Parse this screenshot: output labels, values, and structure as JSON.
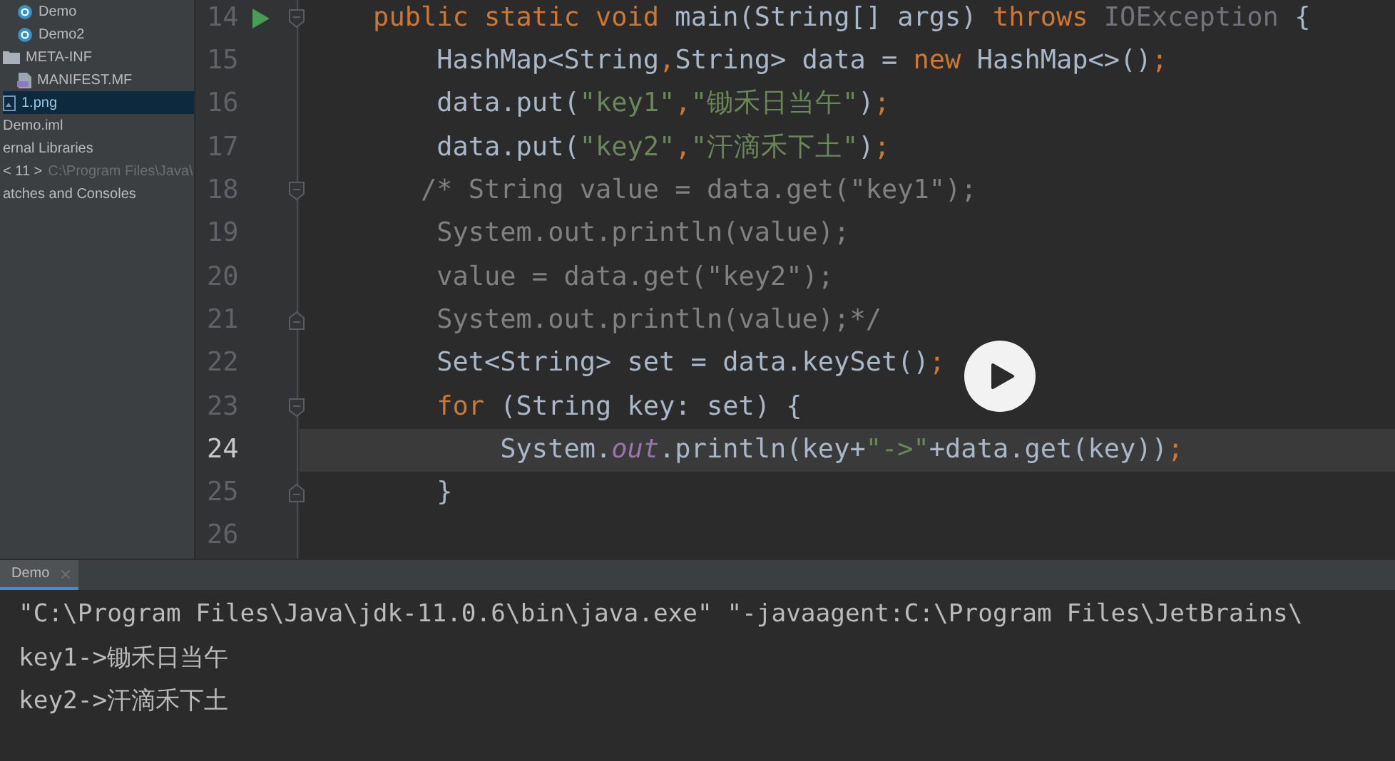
{
  "project_tree": [
    {
      "label": "Demo",
      "kind": "class",
      "selected": false
    },
    {
      "label": "Demo2",
      "kind": "class",
      "selected": false
    },
    {
      "label": "META-INF",
      "kind": "folder",
      "selected": false,
      "children": [
        {
          "label": "MANIFEST.MF",
          "kind": "manifest",
          "selected": false
        }
      ]
    },
    {
      "label": "1.png",
      "kind": "image",
      "selected": true
    },
    {
      "label": "Demo.iml",
      "kind": "module",
      "selected": false
    },
    {
      "label": "ernal Libraries",
      "kind": "plain",
      "selected": false
    },
    {
      "label": "< 11 >",
      "detail": "C:\\Program Files\\Java\\",
      "kind": "plain",
      "selected": false
    },
    {
      "label": "atches and Consoles",
      "kind": "plain",
      "selected": false
    }
  ],
  "editor": {
    "lines": [
      {
        "number": "14",
        "current": false,
        "markers": [
          {
            "kind": "run"
          },
          {
            "kind": "fold_start"
          }
        ],
        "tokens": [
          {
            "kind": "keyword",
            "text": "    public static void"
          },
          {
            "kind": "plain",
            "text": " main(String[] args) "
          },
          {
            "kind": "keyword",
            "text": "throws"
          },
          {
            "kind": "unused",
            "text": " IOException"
          },
          {
            "kind": "plain",
            "text": " {"
          }
        ]
      },
      {
        "number": "15",
        "current": false,
        "tokens": [
          {
            "kind": "plain",
            "text": "        HashMap<String"
          },
          {
            "kind": "keyword",
            "text": ","
          },
          {
            "kind": "plain",
            "text": "String> data = "
          },
          {
            "kind": "keyword",
            "text": "new"
          },
          {
            "kind": "plain",
            "text": " HashMap<>()"
          },
          {
            "kind": "keyword",
            "text": ";"
          }
        ]
      },
      {
        "number": "16",
        "current": false,
        "tokens": [
          {
            "kind": "plain",
            "text": "        data.put("
          },
          {
            "kind": "string",
            "text": "\"key1\""
          },
          {
            "kind": "keyword",
            "text": ","
          },
          {
            "kind": "string",
            "text": "\"锄禾日当午\""
          },
          {
            "kind": "plain",
            "text": ")"
          },
          {
            "kind": "keyword",
            "text": ";"
          }
        ]
      },
      {
        "number": "17",
        "current": false,
        "tokens": [
          {
            "kind": "plain",
            "text": "        data.put("
          },
          {
            "kind": "string",
            "text": "\"key2\""
          },
          {
            "kind": "keyword",
            "text": ","
          },
          {
            "kind": "string",
            "text": "\"汗滴禾下土\""
          },
          {
            "kind": "plain",
            "text": ")"
          },
          {
            "kind": "keyword",
            "text": ";"
          }
        ]
      },
      {
        "number": "18",
        "current": false,
        "markers": [
          {
            "kind": "fold_start"
          }
        ],
        "tokens": [
          {
            "kind": "comment",
            "text": "       /* String value = data.get(\"key1\");"
          }
        ]
      },
      {
        "number": "19",
        "current": false,
        "tokens": [
          {
            "kind": "comment",
            "text": "        System.out.println(value);"
          }
        ]
      },
      {
        "number": "20",
        "current": false,
        "tokens": [
          {
            "kind": "comment",
            "text": "        value = data.get(\"key2\");"
          }
        ]
      },
      {
        "number": "21",
        "current": false,
        "markers": [
          {
            "kind": "fold_end"
          }
        ],
        "tokens": [
          {
            "kind": "comment",
            "text": "        System.out.println(value);*/"
          }
        ]
      },
      {
        "number": "22",
        "current": false,
        "tokens": [
          {
            "kind": "plain",
            "text": "        Set<String> set = data.keySet()"
          },
          {
            "kind": "keyword",
            "text": ";"
          }
        ]
      },
      {
        "number": "23",
        "current": false,
        "markers": [
          {
            "kind": "fold_start"
          }
        ],
        "tokens": [
          {
            "kind": "keyword",
            "text": "        for"
          },
          {
            "kind": "plain",
            "text": " (String key: set) {"
          }
        ]
      },
      {
        "number": "24",
        "current": true,
        "tokens": [
          {
            "kind": "plain",
            "text": "            System."
          },
          {
            "kind": "field",
            "text": "out"
          },
          {
            "kind": "plain",
            "text": ".println(key+"
          },
          {
            "kind": "string",
            "text": "\"->\""
          },
          {
            "kind": "plain",
            "text": "+data.get(key))"
          },
          {
            "kind": "keyword",
            "text": ";"
          }
        ]
      },
      {
        "number": "25",
        "current": false,
        "markers": [
          {
            "kind": "fold_end"
          }
        ],
        "tokens": [
          {
            "kind": "plain",
            "text": "        }"
          }
        ]
      },
      {
        "number": "26",
        "current": false
      }
    ]
  },
  "run_panel": {
    "tabs": [
      {
        "label": "Demo",
        "selected": true
      }
    ],
    "output": [
      "\"C:\\Program Files\\Java\\jdk-11.0.6\\bin\\java.exe\" \"-javaagent:C:\\Program Files\\JetBrains\\",
      "key1->锄禾日当午",
      "key2->汗滴禾下土"
    ]
  }
}
